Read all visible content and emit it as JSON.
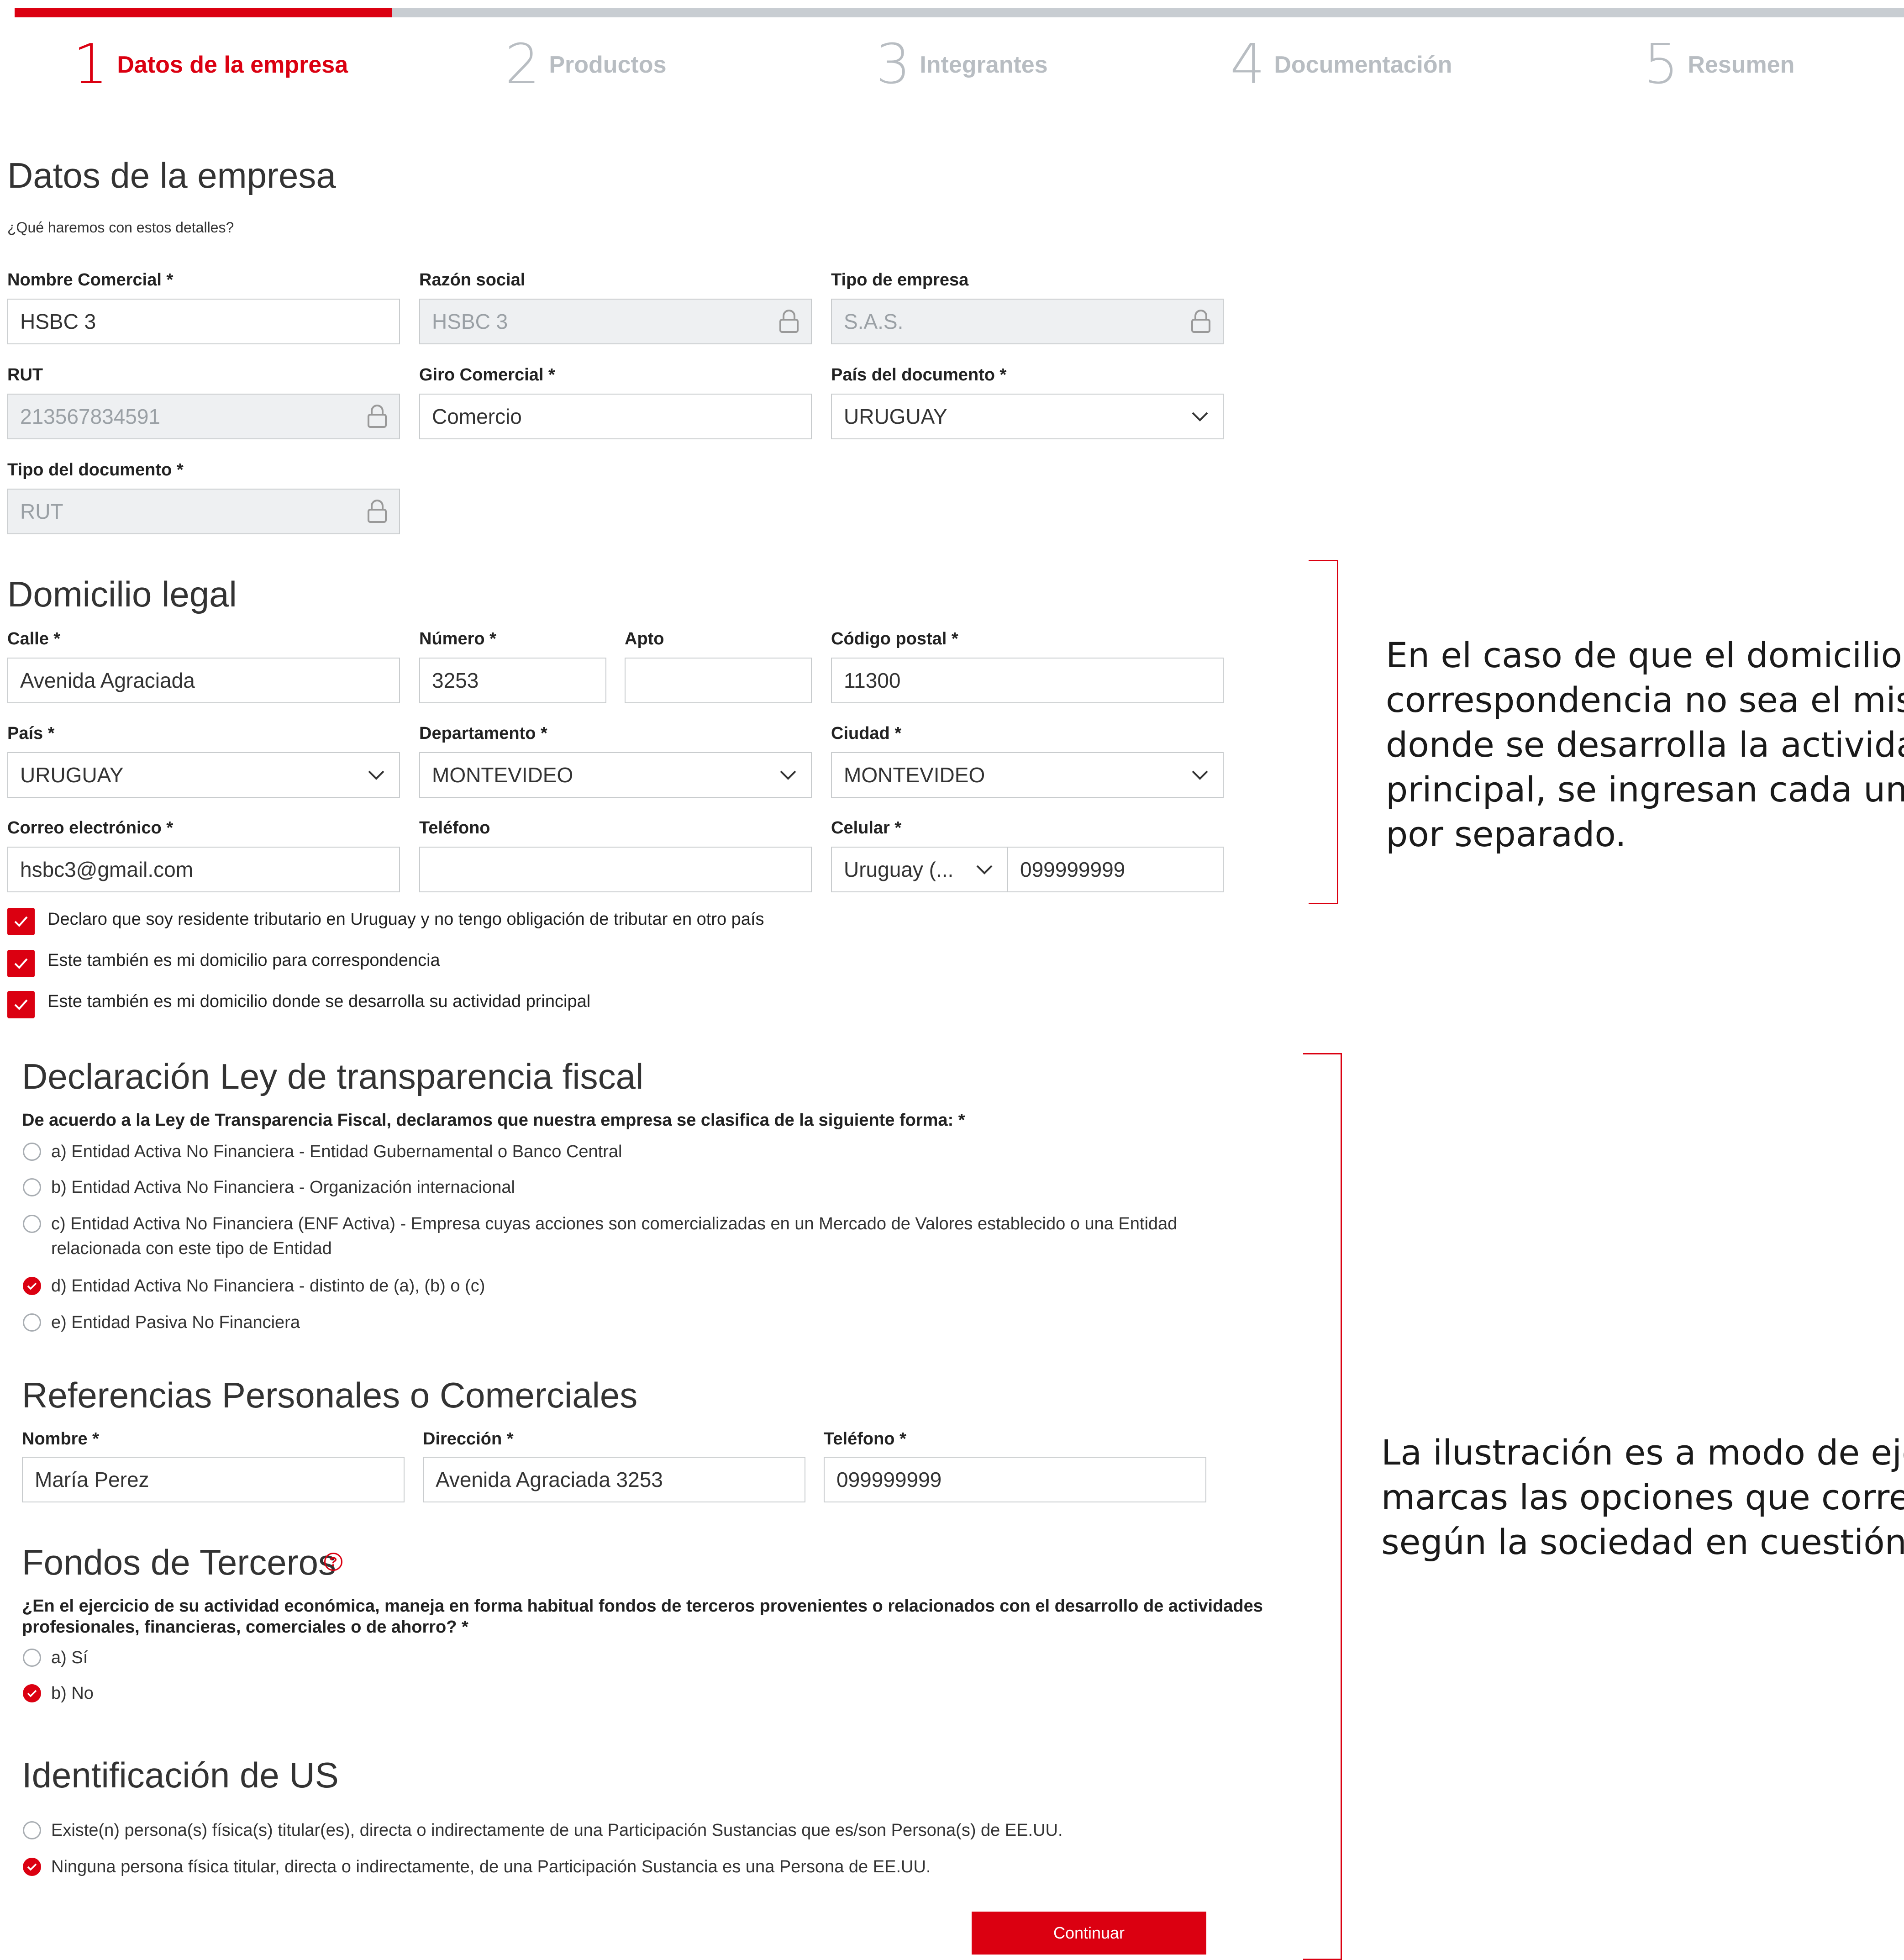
{
  "progress": {
    "current_step": 1,
    "total_steps": 5,
    "fraction": 0.2
  },
  "steps": [
    {
      "num": "1",
      "label": "Datos de la empresa"
    },
    {
      "num": "2",
      "label": "Productos"
    },
    {
      "num": "3",
      "label": "Integrantes"
    },
    {
      "num": "4",
      "label": "Documentación"
    },
    {
      "num": "5",
      "label": "Resumen"
    }
  ],
  "company": {
    "title": "Datos de la empresa",
    "subtitle": "¿Qué haremos con estos detalles?",
    "fields": {
      "nombre_comercial": {
        "label": "Nombre Comercial *",
        "value": "HSBC 3"
      },
      "razon_social": {
        "label": "Razón social",
        "value": "HSBC 3"
      },
      "tipo_empresa": {
        "label": "Tipo de empresa",
        "value": "S.A.S."
      },
      "rut": {
        "label": "RUT",
        "value": "213567834591"
      },
      "giro": {
        "label": "Giro Comercial *",
        "value": "Comercio"
      },
      "pais_doc": {
        "label": "País del documento *",
        "value": "URUGUAY"
      },
      "tipo_doc": {
        "label": "Tipo del documento *",
        "value": "RUT"
      }
    }
  },
  "domicilio": {
    "title": "Domicilio legal",
    "fields": {
      "calle": {
        "label": "Calle *",
        "value": "Avenida Agraciada"
      },
      "numero": {
        "label": "Número *",
        "value": "3253"
      },
      "apto": {
        "label": "Apto",
        "value": ""
      },
      "cp": {
        "label": "Código postal *",
        "value": "11300"
      },
      "pais": {
        "label": "País *",
        "value": "URUGUAY"
      },
      "departamento": {
        "label": "Departamento *",
        "value": "MONTEVIDEO"
      },
      "ciudad": {
        "label": "Ciudad *",
        "value": "MONTEVIDEO"
      },
      "correo": {
        "label": "Correo electrónico *",
        "value": "hsbc3@gmail.com"
      },
      "telefono": {
        "label": "Teléfono",
        "value": ""
      },
      "celular": {
        "label": "Celular *",
        "country": "Uruguay (...",
        "value": "099999999"
      }
    },
    "checks": [
      "Declaro que soy residente tributario en Uruguay y no tengo obligación de tributar en otro país",
      "Este también es mi domicilio para correspondencia",
      "Este también es mi domicilio donde se desarrolla su actividad principal"
    ]
  },
  "transparencia": {
    "title": "Declaración Ley de transparencia fiscal",
    "question": "De acuerdo a la Ley de Transparencia Fiscal, declaramos que nuestra empresa se clasifica de la siguiente forma: *",
    "options": [
      "a) Entidad Activa No Financiera - Entidad Gubernamental o Banco Central",
      "b) Entidad Activa No Financiera - Organización internacional",
      "c) Entidad Activa No Financiera (ENF Activa) - Empresa cuyas acciones son comercializadas en un Mercado de Valores establecido o una Entidad",
      "d) Entidad Activa No Financiera - distinto de (a), (b) o (c)",
      "e) Entidad Pasiva No Financiera"
    ],
    "option_c_cont": "relacionada con este tipo de Entidad",
    "selected_index": 3
  },
  "referencias": {
    "title": "Referencias Personales o Comerciales",
    "nombre": {
      "label": "Nombre *",
      "value": "María Perez"
    },
    "direccion": {
      "label": "Dirección *",
      "value": "Avenida Agraciada 3253"
    },
    "telefono": {
      "label": "Teléfono *",
      "value": "099999999"
    }
  },
  "fondos": {
    "title": "Fondos de Terceros",
    "help": "?",
    "question_l1": "¿En el ejercicio de su actividad económica, maneja en forma habitual fondos de terceros provenientes o relacionados con el desarrollo de actividades",
    "question_l2": "profesionales, financieras, comerciales o de ahorro? *",
    "options": [
      "a) Sí",
      "b) No"
    ],
    "selected_index": 1
  },
  "us": {
    "title": "Identificación de US",
    "options": [
      "Existe(n) persona(s) física(s) titular(es), directa o indirectamente de una Participación Sustancias que es/son Persona(s) de EE.UU.",
      "Ninguna persona física titular, directa o indirectamente, de una Participación Sustancia es una Persona de EE.UU."
    ],
    "selected_index": 1
  },
  "buttons": {
    "continuar": "Continuar"
  },
  "notes": {
    "domicilio": [
      "En el caso de que el domicilio",
      "correspondencia no sea el mis",
      "donde se desarrolla la activida",
      "principal, se ingresan cada uno",
      "por separado."
    ],
    "ilustracion": [
      "La ilustración es a modo de eje",
      "marcas las opciones que corre",
      "según la sociedad en cuestión."
    ]
  },
  "colors": {
    "accent": "#db0011",
    "inactive": "#b8bdc2",
    "locked_bg": "#eef0f2"
  },
  "icons": [
    "lock-icon",
    "chevron-down-icon",
    "check-icon",
    "help-icon"
  ]
}
